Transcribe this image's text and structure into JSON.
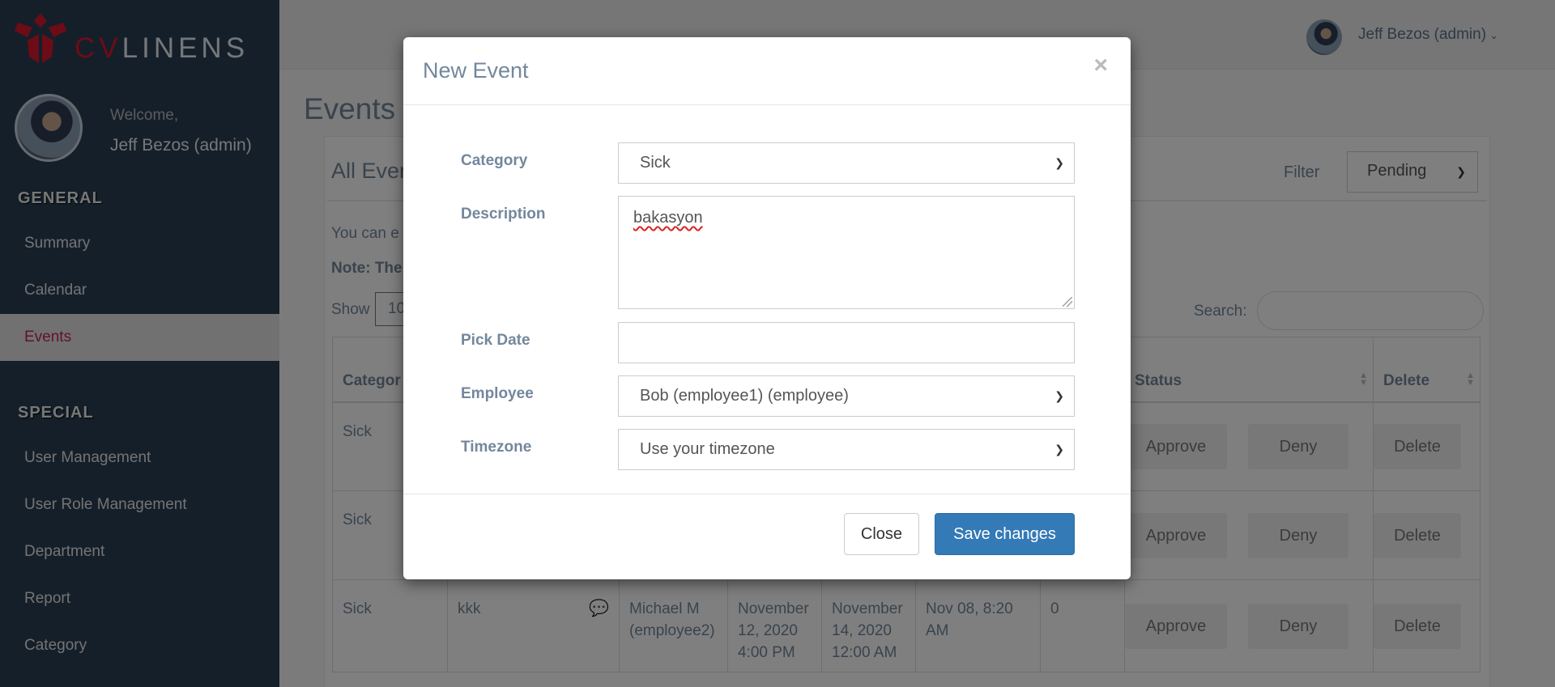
{
  "brand": {
    "logo_cv": "CV",
    "logo_rest": "LINENS",
    "logo_icon": "linen-logo-icon"
  },
  "profile": {
    "welcome": "Welcome,",
    "name": "Jeff Bezos (admin)"
  },
  "sidebar": {
    "section_general": "GENERAL",
    "general_items": [
      {
        "label": "Summary"
      },
      {
        "label": "Calendar"
      },
      {
        "label": "Events",
        "active": true
      }
    ],
    "section_special": "SPECIAL",
    "special_items": [
      {
        "label": "User Management"
      },
      {
        "label": "User Role Management"
      },
      {
        "label": "Department"
      },
      {
        "label": "Report"
      },
      {
        "label": "Category"
      }
    ]
  },
  "topbar": {
    "user": "Jeff Bezos (admin)"
  },
  "page": {
    "title": "Events",
    "panel_title": "All Even",
    "filter_label": "Filter",
    "filter_value": "Pending",
    "info_text": "You can e",
    "note_text": "Note: The",
    "show_label": "Show",
    "show_value": "10",
    "search_label": "Search:"
  },
  "table": {
    "headers": {
      "category": "Categor",
      "status": "Status",
      "delete": "Delete"
    },
    "rows": [
      {
        "category": "Sick",
        "description": "",
        "employee": "",
        "start": "",
        "end": "",
        "created": "",
        "days": "",
        "approve": "Approve",
        "deny": "Deny",
        "delete": "Delete"
      },
      {
        "category": "Sick",
        "description": "",
        "employee": "",
        "start": "",
        "end": "",
        "created": "",
        "days": "",
        "approve": "Approve",
        "deny": "Deny",
        "delete": "Delete"
      },
      {
        "category": "Sick",
        "description": "kkk",
        "employee": "Michael M (employee2)",
        "start": "November 12, 2020 4:00 PM",
        "end": "November 14, 2020 12:00 AM",
        "created": "Nov 08, 8:20 AM",
        "days": "0",
        "approve": "Approve",
        "deny": "Deny",
        "delete": "Delete"
      }
    ]
  },
  "modal": {
    "title": "New Event",
    "close_icon": "×",
    "category_label": "Category",
    "category_value": "Sick",
    "description_label": "Description",
    "description_value": "bakasyon",
    "date_label": "Pick Date",
    "date_value": "",
    "employee_label": "Employee",
    "employee_value": "Bob (employee1) (employee)",
    "timezone_label": "Timezone",
    "timezone_value": "Use your timezone",
    "close_button": "Close",
    "save_button": "Save changes"
  }
}
